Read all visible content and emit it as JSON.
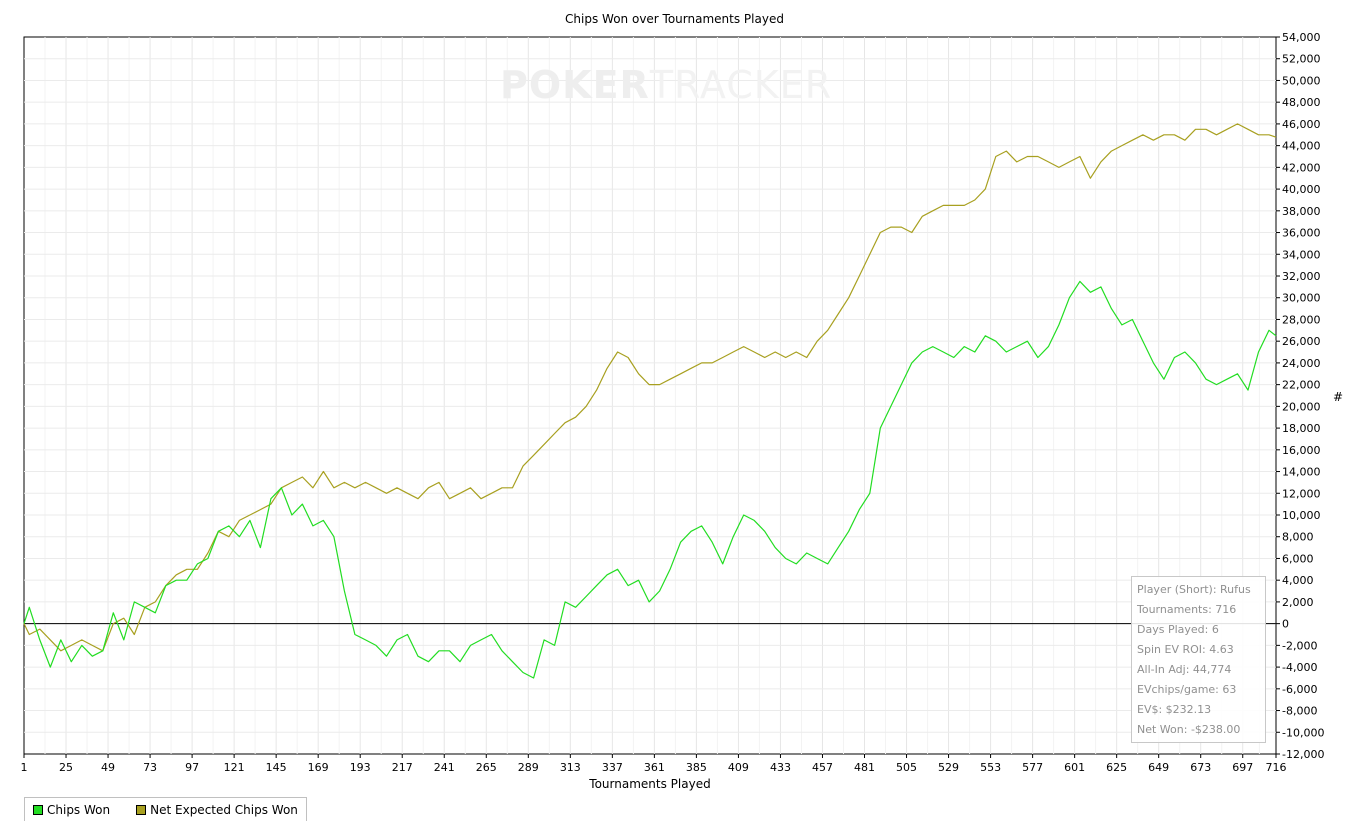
{
  "chart_data": {
    "type": "line",
    "title": "Chips Won over Tournaments Played",
    "xlabel": "Tournaments Played",
    "ylabel": "#",
    "xlim": [
      1,
      716
    ],
    "ylim": [
      -12000,
      54000
    ],
    "x_ticks": [
      1,
      25,
      49,
      73,
      97,
      121,
      145,
      169,
      193,
      217,
      241,
      265,
      289,
      313,
      337,
      361,
      385,
      409,
      433,
      457,
      481,
      505,
      529,
      553,
      577,
      601,
      625,
      649,
      673,
      697,
      716
    ],
    "y_ticks": [
      "54,000",
      "52,000",
      "50,000",
      "48,000",
      "46,000",
      "44,000",
      "42,000",
      "40,000",
      "38,000",
      "36,000",
      "34,000",
      "32,000",
      "30,000",
      "28,000",
      "26,000",
      "24,000",
      "22,000",
      "20,000",
      "18,000",
      "16,000",
      "14,000",
      "12,000",
      "10,000",
      "8,000",
      "6,000",
      "4,000",
      "2,000",
      "0",
      "-2,000",
      "-4,000",
      "-6,000",
      "-8,000",
      "-10,000",
      "-12,000"
    ],
    "grid": true,
    "legend_position": "bottom-left",
    "series": [
      {
        "name": "Chips Won",
        "color": "#22dd22",
        "x": [
          1,
          4,
          10,
          16,
          22,
          28,
          34,
          40,
          46,
          52,
          58,
          64,
          70,
          76,
          82,
          88,
          94,
          100,
          106,
          112,
          118,
          124,
          130,
          136,
          142,
          148,
          154,
          160,
          166,
          172,
          178,
          184,
          190,
          196,
          202,
          208,
          214,
          220,
          226,
          232,
          238,
          244,
          250,
          256,
          262,
          268,
          274,
          280,
          286,
          292,
          298,
          304,
          310,
          316,
          322,
          328,
          334,
          340,
          346,
          352,
          358,
          364,
          370,
          376,
          382,
          388,
          394,
          400,
          406,
          412,
          418,
          424,
          430,
          436,
          442,
          448,
          454,
          460,
          466,
          472,
          478,
          484,
          490,
          496,
          502,
          508,
          514,
          520,
          526,
          532,
          538,
          544,
          550,
          556,
          562,
          568,
          574,
          580,
          586,
          592,
          598,
          604,
          610,
          616,
          622,
          628,
          634,
          640,
          646,
          652,
          658,
          664,
          670,
          676,
          682,
          688,
          694,
          700,
          706,
          712,
          716
        ],
        "values": [
          0,
          1500,
          -1500,
          -4000,
          -1500,
          -3500,
          -2000,
          -3000,
          -2500,
          1000,
          -1500,
          2000,
          1500,
          1000,
          3500,
          4000,
          4000,
          5500,
          6000,
          8500,
          9000,
          8000,
          9500,
          7000,
          11500,
          12500,
          10000,
          11000,
          9000,
          9500,
          8000,
          3000,
          -1000,
          -1500,
          -2000,
          -3000,
          -1500,
          -1000,
          -3000,
          -3500,
          -2500,
          -2500,
          -3500,
          -2000,
          -1500,
          -1000,
          -2500,
          -3500,
          -4500,
          -5000,
          -1500,
          -2000,
          2000,
          1500,
          2500,
          3500,
          4500,
          5000,
          3500,
          4000,
          2000,
          3000,
          5000,
          7500,
          8500,
          9000,
          7500,
          5500,
          8000,
          10000,
          9500,
          8500,
          7000,
          6000,
          5500,
          6500,
          6000,
          5500,
          7000,
          8500,
          10500,
          12000,
          18000,
          20000,
          22000,
          24000,
          25000,
          25500,
          25000,
          24500,
          25500,
          25000,
          26500,
          26000,
          25000,
          25500,
          26000,
          24500,
          25500,
          27500,
          30000,
          31500,
          30500,
          31000,
          29000,
          27500,
          28000,
          26000,
          24000,
          22500,
          24500,
          25000,
          24000,
          22500,
          22000,
          22500,
          23000,
          21500,
          25000,
          27000,
          26500
        ]
      },
      {
        "name": "Net Expected Chips Won",
        "color": "#a8a020",
        "x": [
          1,
          4,
          10,
          16,
          22,
          28,
          34,
          40,
          46,
          52,
          58,
          64,
          70,
          76,
          82,
          88,
          94,
          100,
          106,
          112,
          118,
          124,
          130,
          136,
          142,
          148,
          154,
          160,
          166,
          172,
          178,
          184,
          190,
          196,
          202,
          208,
          214,
          220,
          226,
          232,
          238,
          244,
          250,
          256,
          262,
          268,
          274,
          280,
          286,
          292,
          298,
          304,
          310,
          316,
          322,
          328,
          334,
          340,
          346,
          352,
          358,
          364,
          370,
          376,
          382,
          388,
          394,
          400,
          406,
          412,
          418,
          424,
          430,
          436,
          442,
          448,
          454,
          460,
          466,
          472,
          478,
          484,
          490,
          496,
          502,
          508,
          514,
          520,
          526,
          532,
          538,
          544,
          550,
          556,
          562,
          568,
          574,
          580,
          586,
          592,
          598,
          604,
          610,
          616,
          622,
          628,
          634,
          640,
          646,
          652,
          658,
          664,
          670,
          676,
          682,
          688,
          694,
          700,
          706,
          712,
          716
        ],
        "values": [
          0,
          -1000,
          -500,
          -1500,
          -2500,
          -2000,
          -1500,
          -2000,
          -2500,
          0,
          500,
          -1000,
          1500,
          2000,
          3500,
          4500,
          5000,
          5000,
          6500,
          8500,
          8000,
          9500,
          10000,
          10500,
          11000,
          12500,
          13000,
          13500,
          12500,
          14000,
          12500,
          13000,
          12500,
          13000,
          12500,
          12000,
          12500,
          12000,
          11500,
          12500,
          13000,
          11500,
          12000,
          12500,
          11500,
          12000,
          12500,
          12500,
          14500,
          15500,
          16500,
          17500,
          18500,
          19000,
          20000,
          21500,
          23500,
          25000,
          24500,
          23000,
          22000,
          22000,
          22500,
          23000,
          23500,
          24000,
          24000,
          24500,
          25000,
          25500,
          25000,
          24500,
          25000,
          24500,
          25000,
          24500,
          26000,
          27000,
          28500,
          30000,
          32000,
          34000,
          36000,
          36500,
          36500,
          36000,
          37500,
          38000,
          38500,
          38500,
          38500,
          39000,
          40000,
          43000,
          43500,
          42500,
          43000,
          43000,
          42500,
          42000,
          42500,
          43000,
          41000,
          42500,
          43500,
          44000,
          44500,
          45000,
          44500,
          45000,
          45000,
          44500,
          45500,
          45500,
          45000,
          45500,
          46000,
          45500,
          45000,
          45000,
          44774
        ]
      }
    ],
    "reference_line": 0
  },
  "watermark": {
    "brand_bold": "POKER",
    "brand_light": "TRACKER"
  },
  "stats": [
    "Player (Short): Rufus",
    "Tournaments: 716",
    "Days Played: 6",
    "Spin EV ROI: 4.63",
    "All-In Adj: 44,774",
    "EVchips/game: 63",
    "EV$: $232.13",
    "Net Won: -$238.00"
  ]
}
